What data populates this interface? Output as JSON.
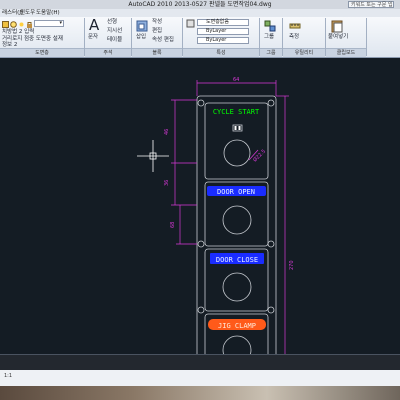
{
  "window": {
    "title": "AutoCAD 2010    2013-0527 판넬들 도면작업04.dwg",
    "search_placeholder": "키워드 또는 구문 입력"
  },
  "menubar": {
    "items": [
      "래스터(J)",
      "윈도우",
      "도움말(H)"
    ]
  },
  "ribbon": {
    "draw_items": [
      "치방법 2 입력",
      "거리로지 점중 도면중 설재",
      "정보 2"
    ],
    "annotation_big_label": "문자",
    "annotation_items": [
      "선형",
      "지시선",
      "테이블"
    ],
    "block_big_label": "삽입",
    "block_items": [
      "작성",
      "편집",
      "속성 편집"
    ],
    "layer_dropdowns": [
      "ByLayer",
      "ByLayer",
      "ByLayer"
    ],
    "layer_top_dropdown": "도면층없음",
    "group_button": "그룹",
    "measure_button": "측정",
    "paste_button": "붙여넣기",
    "group_labels": [
      "도면층",
      "주석",
      "블록",
      "특성",
      "그룹",
      "유틸리티",
      "클립보드"
    ]
  },
  "drawing": {
    "labels": [
      {
        "text": "CYCLE START",
        "fill": "#00ff00",
        "bg": "none"
      },
      {
        "text": "DOOR OPEN",
        "fill": "#e8f0ff",
        "bg": "#1a2cff"
      },
      {
        "text": "DOOR CLOSE",
        "fill": "#e8f0ff",
        "bg": "#1a2cff"
      },
      {
        "text": "JIG CLAMP",
        "fill": "#ffe8d8",
        "bg": "#ff5a1a"
      }
    ],
    "dim_top": "64",
    "dim_side_1": "46",
    "dim_side_2": "36",
    "dim_side_3": "68",
    "dim_right": "270",
    "dim_diameter": "Ø22.5",
    "colors": {
      "background": "#141c24",
      "outline": "#c8ccd2",
      "dimension": "#d838d8",
      "green_label": "#00ff00"
    }
  },
  "statusbar": {
    "coord": "1:1"
  }
}
